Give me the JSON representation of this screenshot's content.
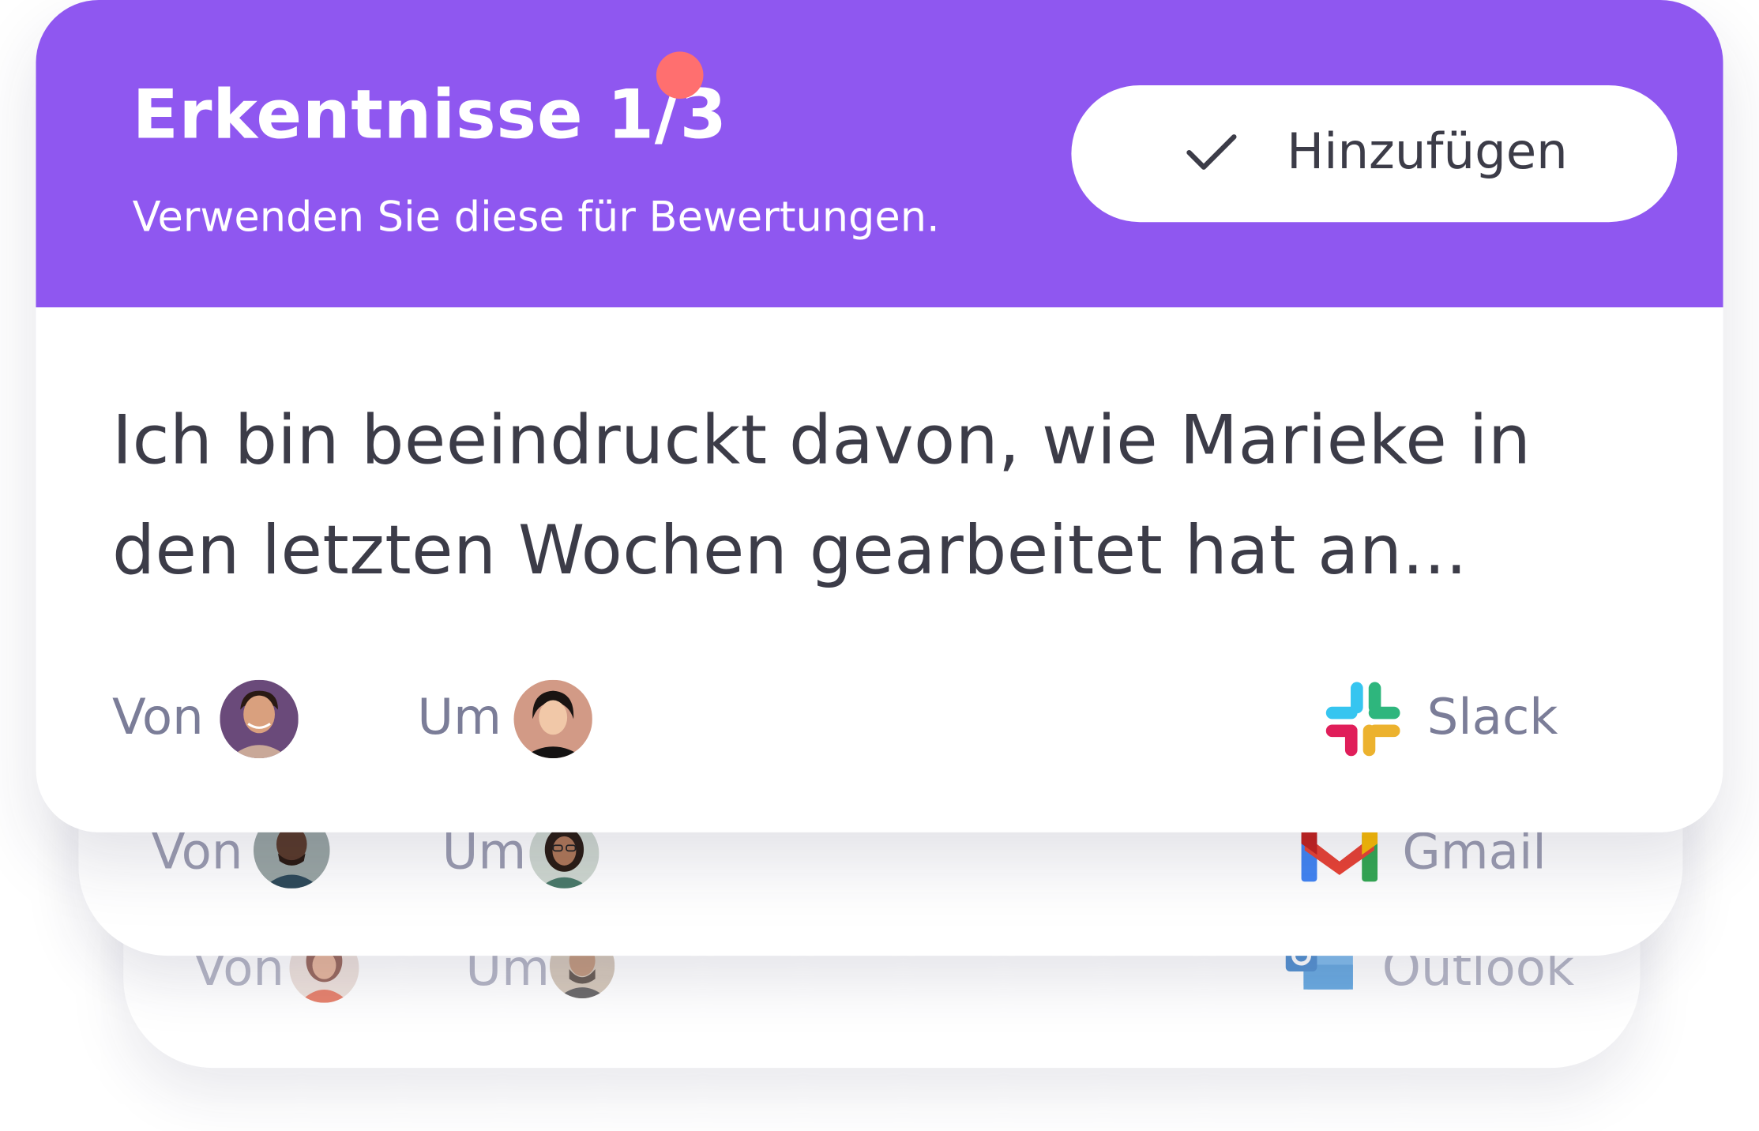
{
  "header": {
    "title": "Erkentnisse 1/3",
    "subtitle": "Verwenden Sie diese für Bewertungen.",
    "add_button_label": "Hinzufügen"
  },
  "insights": [
    {
      "text": "Ich bin beeindruckt davon, wie Marieke in den letzten Wochen gearbeitet hat an...",
      "from_label": "Von",
      "to_label": "Um",
      "source": "Slack"
    },
    {
      "from_label": "Von",
      "to_label": "Um",
      "source": "Gmail"
    },
    {
      "from_label": "Von",
      "to_label": "Um",
      "source": "Outlook"
    }
  ],
  "colors": {
    "header_bg": "#8f57f0",
    "notification_dot": "#ff6f6f",
    "text_dark": "#3c3c48",
    "text_muted": "#7b7d98"
  },
  "icons": [
    "check-icon",
    "slack-logo-icon",
    "gmail-logo-icon",
    "outlook-logo-icon"
  ]
}
